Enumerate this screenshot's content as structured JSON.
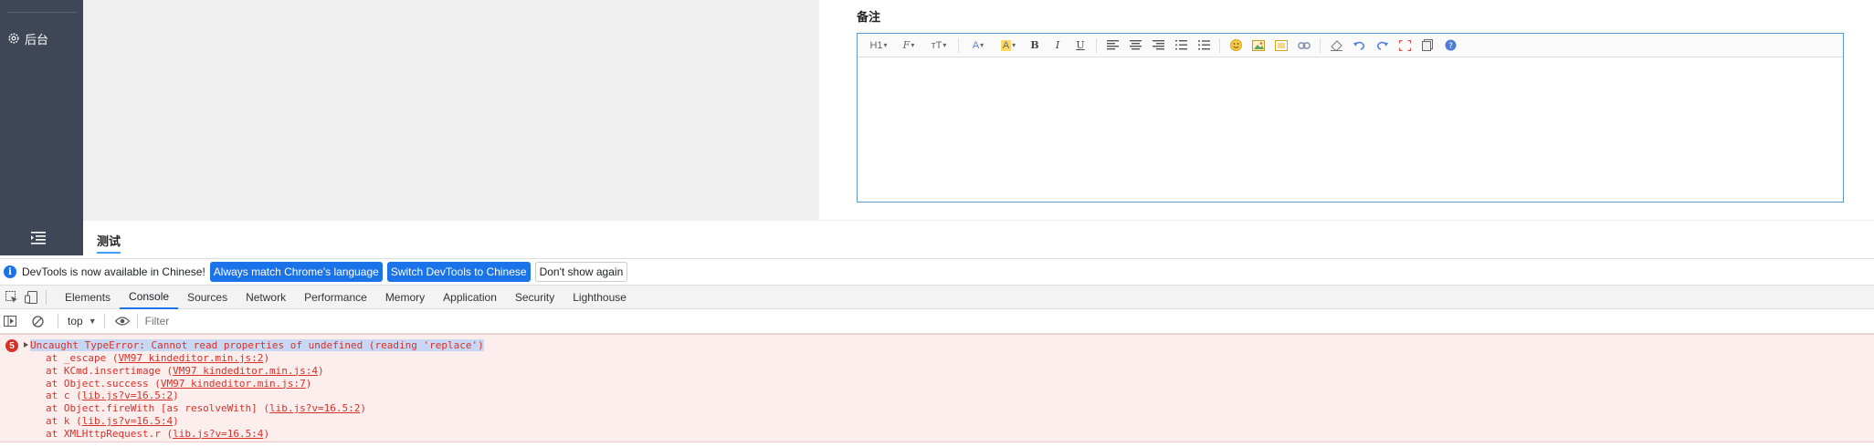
{
  "sidebar": {
    "nav_item_label": "后台",
    "nav_item_icon": "gear-icon",
    "toggle_icon": "menu-fold-icon"
  },
  "form": {
    "remark_label": "备注"
  },
  "editor": {
    "toolbar": [
      {
        "name": "heading",
        "label": "H1",
        "icon": "heading-icon"
      },
      {
        "name": "font-family",
        "label": "F",
        "icon": "font-family-icon"
      },
      {
        "name": "font-size",
        "label": "тT",
        "icon": "font-size-icon"
      },
      {
        "name": "font-color",
        "label": "A",
        "icon": "font-color-icon"
      },
      {
        "name": "highlight",
        "label": "A",
        "icon": "highlight-icon"
      },
      {
        "name": "bold",
        "label": "B",
        "icon": "bold-icon"
      },
      {
        "name": "italic",
        "label": "I",
        "icon": "italic-icon"
      },
      {
        "name": "underline",
        "label": "U",
        "icon": "underline-icon"
      }
    ]
  },
  "tabs": {
    "active_tab": "测试"
  },
  "devtools": {
    "infobar": {
      "message": "DevTools is now available in Chinese!",
      "btn_match": "Always match Chrome's language",
      "btn_switch": "Switch DevTools to Chinese",
      "btn_dismiss": "Don't show again"
    },
    "tabs": [
      "Elements",
      "Console",
      "Sources",
      "Network",
      "Performance",
      "Memory",
      "Application",
      "Security",
      "Lighthouse"
    ],
    "active_tab": "Console",
    "context": "top",
    "filter_placeholder": "Filter",
    "error": {
      "count": "5",
      "message": "Uncaught TypeError: Cannot read properties of undefined (reading 'replace')",
      "frames": [
        {
          "fn": "at _escape",
          "src": "VM97 kindeditor.min.js:2"
        },
        {
          "fn": "at KCmd.insertimage",
          "src": "VM97 kindeditor.min.js:4"
        },
        {
          "fn": "at Object.success",
          "src": "VM97 kindeditor.min.js:7"
        },
        {
          "fn": "at c",
          "src": "lib.js?v=16.5:2"
        },
        {
          "fn": "at Object.fireWith [as resolveWith]",
          "src": "lib.js?v=16.5:2"
        },
        {
          "fn": "at k",
          "src": "lib.js?v=16.5:4"
        },
        {
          "fn": "at XMLHttpRequest.r",
          "src": "lib.js?v=16.5:4"
        }
      ]
    }
  },
  "colors": {
    "sidebar_bg": "#3f4656",
    "accent": "#1a73e8",
    "error_text": "#d93025",
    "error_bg": "#fdeeee"
  }
}
